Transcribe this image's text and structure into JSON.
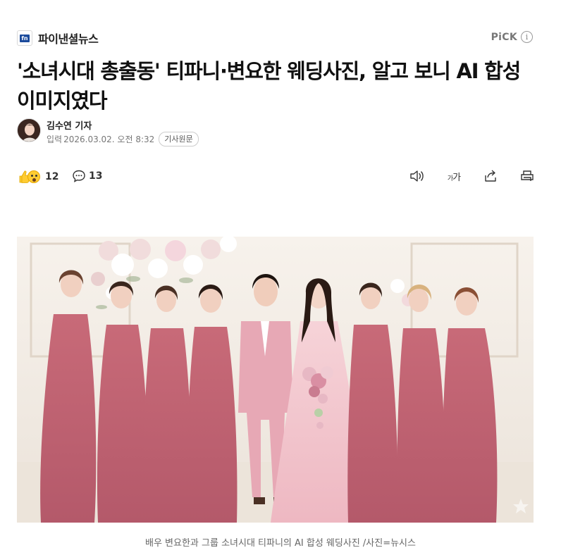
{
  "press": {
    "logo_text": "fn",
    "name": "파이낸셜뉴스"
  },
  "pick": {
    "label": "PiCK",
    "info_icon": "info-icon"
  },
  "headline": "'소녀시대 총출동' 티파니·변요한 웨딩사진, 알고 보니 AI 합성 이미지였다",
  "byline": {
    "author": "김수연 기자",
    "date_label": "입력",
    "date": "2026.03.02. 오전 8:32",
    "original_button": "기사원문"
  },
  "reactions": {
    "icons": [
      "thumbs-up-icon",
      "surprised-icon"
    ],
    "count": "12"
  },
  "comments": {
    "icon": "comment-icon",
    "count": "13"
  },
  "tools": {
    "audio_icon": "speaker-icon",
    "font_icon": "font-size-icon",
    "font_label_small": "가",
    "font_label_big": "가",
    "share_icon": "share-icon",
    "print_icon": "print-icon"
  },
  "photo": {
    "alt": "wedding-photo"
  },
  "caption": "배우 변요한과 그룹 소녀시대 티파니의 AI 합성 웨딩사진 /사진=뉴시스",
  "colors": {
    "dress": "#c96a77",
    "suit": "#e6a7b3",
    "gown": "#f4c8d0",
    "backdrop": "#f3ede6"
  }
}
